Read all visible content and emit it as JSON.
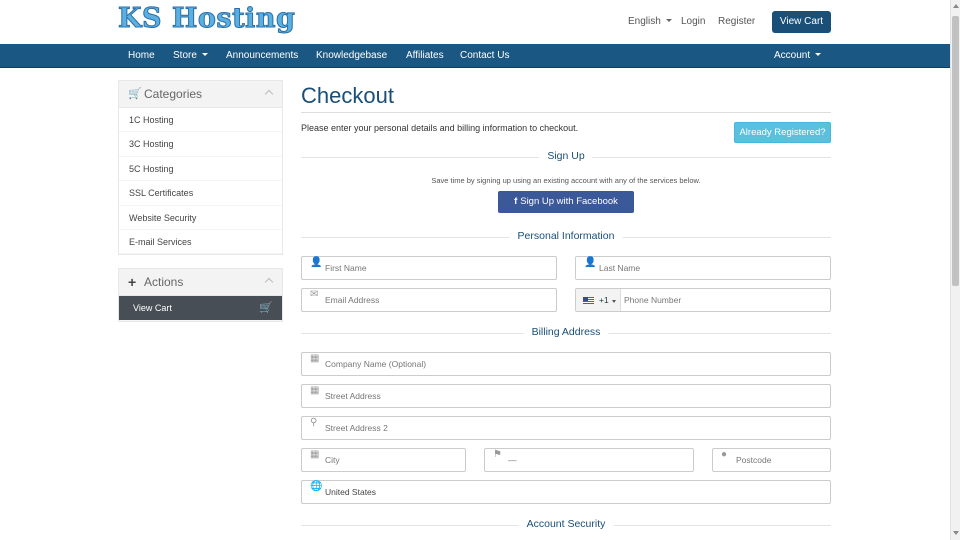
{
  "header": {
    "logo": "KS Hosting",
    "language": "English",
    "login": "Login",
    "register": "Register",
    "view_cart": "View Cart"
  },
  "nav": {
    "home": "Home",
    "store": "Store",
    "announcements": "Announcements",
    "knowledgebase": "Knowledgebase",
    "affiliates": "Affiliates",
    "contact": "Contact Us",
    "account": "Account"
  },
  "sidebar": {
    "categories_title": "Categories",
    "categories": [
      "1C Hosting",
      "3C Hosting",
      "5C Hosting",
      "SSL Certificates",
      "Website Security",
      "E-mail Services"
    ],
    "actions_title": "Actions",
    "view_cart": "View Cart"
  },
  "checkout": {
    "title": "Checkout",
    "intro": "Please enter your personal details and billing information to checkout.",
    "already_registered": "Already Registered?",
    "signup_heading": "Sign Up",
    "signup_note": "Save time by signing up using an existing account with any of the services below.",
    "facebook_button": "Sign Up with Facebook",
    "personal_heading": "Personal Information",
    "first_name": "First Name",
    "last_name": "Last Name",
    "email": "Email Address",
    "phone_code": "+1",
    "phone": "Phone Number",
    "billing_heading": "Billing Address",
    "company": "Company Name (Optional)",
    "street1": "Street Address",
    "street2": "Street Address 2",
    "city": "City",
    "state": "—",
    "postcode": "Postcode",
    "country": "United States",
    "security_heading": "Account Security"
  },
  "colors": {
    "nav_bg": "#1a5883",
    "primary": "#1a4f78",
    "info": "#5bc0de",
    "facebook": "#3b5998"
  },
  "icons": {
    "categories": "shopping-cart-icon",
    "actions": "plus-icon",
    "view_cart": "shopping-cart-icon",
    "facebook": "facebook-icon",
    "name": "user-icon",
    "email": "envelope-icon",
    "company": "building-icon",
    "street": "building-icon",
    "street2": "map-marker-icon",
    "city": "building-icon",
    "state": "signpost-icon",
    "postcode": "certificate-icon",
    "country": "globe-icon"
  }
}
